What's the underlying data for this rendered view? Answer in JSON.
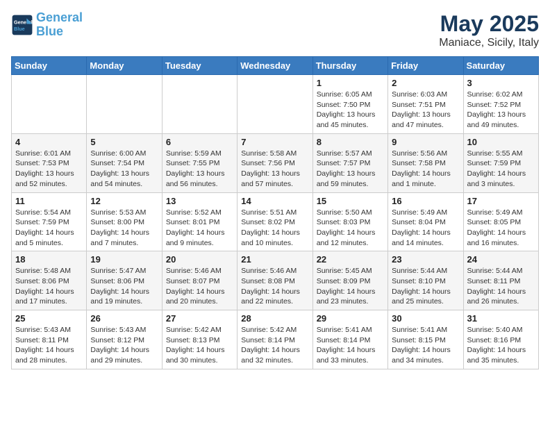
{
  "header": {
    "logo_line1": "General",
    "logo_line2": "Blue",
    "month": "May 2025",
    "location": "Maniace, Sicily, Italy"
  },
  "days_of_week": [
    "Sunday",
    "Monday",
    "Tuesday",
    "Wednesday",
    "Thursday",
    "Friday",
    "Saturday"
  ],
  "weeks": [
    [
      {
        "day": "",
        "info": ""
      },
      {
        "day": "",
        "info": ""
      },
      {
        "day": "",
        "info": ""
      },
      {
        "day": "",
        "info": ""
      },
      {
        "day": "1",
        "info": "Sunrise: 6:05 AM\nSunset: 7:50 PM\nDaylight: 13 hours\nand 45 minutes."
      },
      {
        "day": "2",
        "info": "Sunrise: 6:03 AM\nSunset: 7:51 PM\nDaylight: 13 hours\nand 47 minutes."
      },
      {
        "day": "3",
        "info": "Sunrise: 6:02 AM\nSunset: 7:52 PM\nDaylight: 13 hours\nand 49 minutes."
      }
    ],
    [
      {
        "day": "4",
        "info": "Sunrise: 6:01 AM\nSunset: 7:53 PM\nDaylight: 13 hours\nand 52 minutes."
      },
      {
        "day": "5",
        "info": "Sunrise: 6:00 AM\nSunset: 7:54 PM\nDaylight: 13 hours\nand 54 minutes."
      },
      {
        "day": "6",
        "info": "Sunrise: 5:59 AM\nSunset: 7:55 PM\nDaylight: 13 hours\nand 56 minutes."
      },
      {
        "day": "7",
        "info": "Sunrise: 5:58 AM\nSunset: 7:56 PM\nDaylight: 13 hours\nand 57 minutes."
      },
      {
        "day": "8",
        "info": "Sunrise: 5:57 AM\nSunset: 7:57 PM\nDaylight: 13 hours\nand 59 minutes."
      },
      {
        "day": "9",
        "info": "Sunrise: 5:56 AM\nSunset: 7:58 PM\nDaylight: 14 hours\nand 1 minute."
      },
      {
        "day": "10",
        "info": "Sunrise: 5:55 AM\nSunset: 7:59 PM\nDaylight: 14 hours\nand 3 minutes."
      }
    ],
    [
      {
        "day": "11",
        "info": "Sunrise: 5:54 AM\nSunset: 7:59 PM\nDaylight: 14 hours\nand 5 minutes."
      },
      {
        "day": "12",
        "info": "Sunrise: 5:53 AM\nSunset: 8:00 PM\nDaylight: 14 hours\nand 7 minutes."
      },
      {
        "day": "13",
        "info": "Sunrise: 5:52 AM\nSunset: 8:01 PM\nDaylight: 14 hours\nand 9 minutes."
      },
      {
        "day": "14",
        "info": "Sunrise: 5:51 AM\nSunset: 8:02 PM\nDaylight: 14 hours\nand 10 minutes."
      },
      {
        "day": "15",
        "info": "Sunrise: 5:50 AM\nSunset: 8:03 PM\nDaylight: 14 hours\nand 12 minutes."
      },
      {
        "day": "16",
        "info": "Sunrise: 5:49 AM\nSunset: 8:04 PM\nDaylight: 14 hours\nand 14 minutes."
      },
      {
        "day": "17",
        "info": "Sunrise: 5:49 AM\nSunset: 8:05 PM\nDaylight: 14 hours\nand 16 minutes."
      }
    ],
    [
      {
        "day": "18",
        "info": "Sunrise: 5:48 AM\nSunset: 8:06 PM\nDaylight: 14 hours\nand 17 minutes."
      },
      {
        "day": "19",
        "info": "Sunrise: 5:47 AM\nSunset: 8:06 PM\nDaylight: 14 hours\nand 19 minutes."
      },
      {
        "day": "20",
        "info": "Sunrise: 5:46 AM\nSunset: 8:07 PM\nDaylight: 14 hours\nand 20 minutes."
      },
      {
        "day": "21",
        "info": "Sunrise: 5:46 AM\nSunset: 8:08 PM\nDaylight: 14 hours\nand 22 minutes."
      },
      {
        "day": "22",
        "info": "Sunrise: 5:45 AM\nSunset: 8:09 PM\nDaylight: 14 hours\nand 23 minutes."
      },
      {
        "day": "23",
        "info": "Sunrise: 5:44 AM\nSunset: 8:10 PM\nDaylight: 14 hours\nand 25 minutes."
      },
      {
        "day": "24",
        "info": "Sunrise: 5:44 AM\nSunset: 8:11 PM\nDaylight: 14 hours\nand 26 minutes."
      }
    ],
    [
      {
        "day": "25",
        "info": "Sunrise: 5:43 AM\nSunset: 8:11 PM\nDaylight: 14 hours\nand 28 minutes."
      },
      {
        "day": "26",
        "info": "Sunrise: 5:43 AM\nSunset: 8:12 PM\nDaylight: 14 hours\nand 29 minutes."
      },
      {
        "day": "27",
        "info": "Sunrise: 5:42 AM\nSunset: 8:13 PM\nDaylight: 14 hours\nand 30 minutes."
      },
      {
        "day": "28",
        "info": "Sunrise: 5:42 AM\nSunset: 8:14 PM\nDaylight: 14 hours\nand 32 minutes."
      },
      {
        "day": "29",
        "info": "Sunrise: 5:41 AM\nSunset: 8:14 PM\nDaylight: 14 hours\nand 33 minutes."
      },
      {
        "day": "30",
        "info": "Sunrise: 5:41 AM\nSunset: 8:15 PM\nDaylight: 14 hours\nand 34 minutes."
      },
      {
        "day": "31",
        "info": "Sunrise: 5:40 AM\nSunset: 8:16 PM\nDaylight: 14 hours\nand 35 minutes."
      }
    ]
  ]
}
